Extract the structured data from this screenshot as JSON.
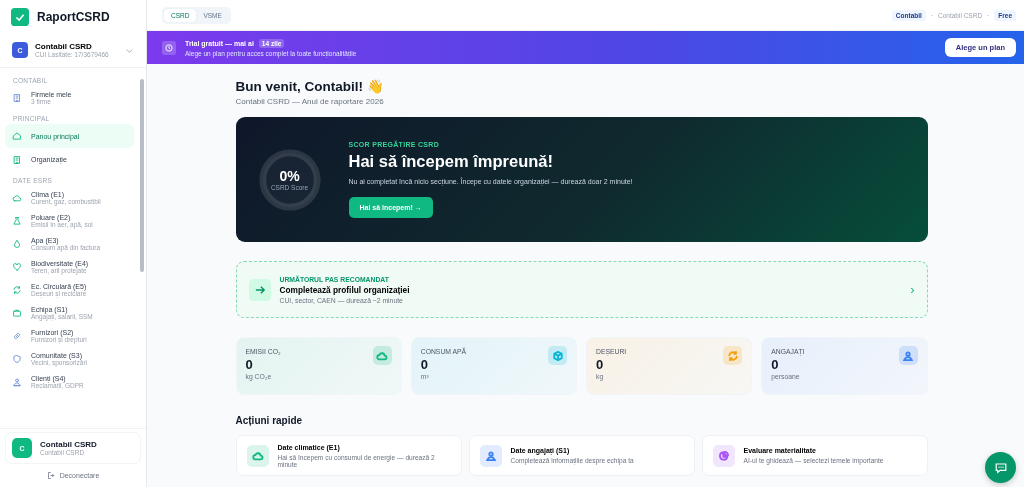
{
  "app": {
    "name": "RaportCSRD"
  },
  "org_switcher": {
    "initial": "C",
    "name": "Contabil CSRD",
    "sublabel": "CUI Lasitate: 17/3679466"
  },
  "sidebar": {
    "sections": [
      {
        "label": "CONTABIL",
        "items": [
          {
            "label": "Firmele mele",
            "sublabel": "3 firme",
            "selected": false
          }
        ]
      },
      {
        "label": "PRINCIPAL",
        "items": [
          {
            "label": "Panou principal",
            "selected": true
          },
          {
            "label": "Organizație",
            "selected": false
          }
        ]
      },
      {
        "label": "DATE ESRS",
        "items": [
          {
            "label": "Clima (E1)",
            "sublabel": "Curent, gaz, combustibil",
            "selected": false
          },
          {
            "label": "Poluare (E2)",
            "sublabel": "Emisii în aer, apă, sol",
            "selected": false
          },
          {
            "label": "Apa (E3)",
            "sublabel": "Consum apă din factura",
            "selected": false
          },
          {
            "label": "Biodiversitate (E4)",
            "sublabel": "Teren, arii protejate",
            "selected": false
          },
          {
            "label": "Ec. Circulară (E5)",
            "sublabel": "Deșeuri și reciclare",
            "selected": false
          },
          {
            "label": "Echipa (S1)",
            "sublabel": "Angajați, salarii, SSM",
            "selected": false
          },
          {
            "label": "Furnizori (S2)",
            "sublabel": "Furnizori și drepturi",
            "selected": false
          },
          {
            "label": "Comunitate (S3)",
            "sublabel": "Vecini, sponsorizări",
            "selected": false
          },
          {
            "label": "Clienți (S4)",
            "sublabel": "Reclamații, GDPR",
            "selected": false
          }
        ]
      }
    ]
  },
  "user": {
    "initial": "C",
    "name": "Contabil CSRD",
    "role": "Contabil CSRD"
  },
  "logout": "Deconectare",
  "mode_tabs": [
    {
      "label": "CSRD",
      "selected": true
    },
    {
      "label": "VSME",
      "selected": false
    }
  ],
  "topbar": {
    "role_badge": "Contabil",
    "separator_1": "·",
    "company": "Contabil CSRD",
    "separator_2": "·",
    "plan_badge": "Free"
  },
  "trial_banner": {
    "title": "Trial gratuit — mai ai",
    "days_badge": "14 zile",
    "subtitle": "Alege un plan pentru acces complet la toate funcționalitățile",
    "button": "Alege un plan"
  },
  "welcome": {
    "title": "Bun venit, Contabil! 👋",
    "subtitle": "Contabil CSRD — Anul de raportare 2026"
  },
  "score_card": {
    "percent": "0%",
    "ring_label": "CSRD Score",
    "level": 0,
    "eyebrow": "SCOR PREGĂTIRE CSRD",
    "title": "Hai să începem împreună!",
    "text": "Nu ai completat încă nicio secțiune. Începe cu datele organizației — durează doar 2 minute!",
    "button": "Hai să începem! →"
  },
  "next_step": {
    "eyebrow": "URMĂTORUL PAS RECOMANDAT",
    "title": "Completează profilul organizației",
    "subtitle": "CUI, sector, CAEN — durează ~2 minute",
    "chevron": "›"
  },
  "stats": [
    {
      "label": "EMISII CO₂",
      "value": "0",
      "unit": "kg CO₂e",
      "color": "#10b981"
    },
    {
      "label": "CONSUM APĂ",
      "value": "0",
      "unit": "m³",
      "color": "#06b6d4"
    },
    {
      "label": "DEȘEURI",
      "value": "0",
      "unit": "kg",
      "color": "#f59e0b"
    },
    {
      "label": "ANGAJAȚI",
      "value": "0",
      "unit": "persoane",
      "color": "#3b82f6"
    }
  ],
  "quick_actions": {
    "title": "Acțiuni rapide",
    "items": [
      {
        "title": "Date climatice (E1)",
        "text": "Hai să începem cu consumul de energie — durează 2 minute",
        "color": "#10b981"
      },
      {
        "title": "Date angajați (S1)",
        "text": "Completează informațiile despre echipa ta",
        "color": "#3b82f6"
      },
      {
        "title": "Evaluare materialitate",
        "text": "AI-ul te ghidează — selectezi temele importante",
        "color": "#a855f7"
      }
    ]
  }
}
